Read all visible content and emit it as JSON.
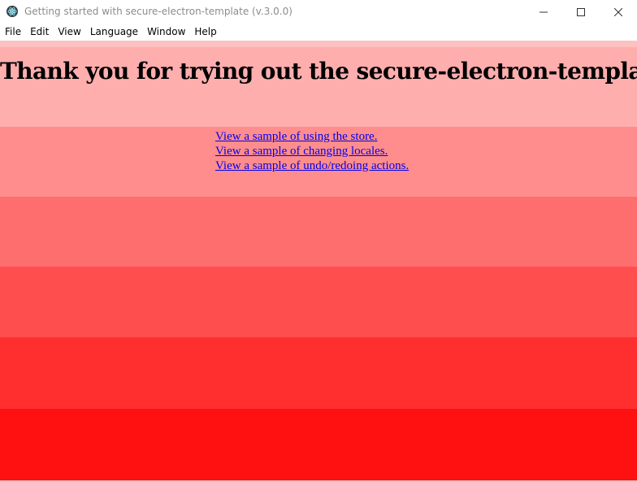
{
  "window": {
    "title": "Getting started with secure-electron-template (v.3.0.0)",
    "app_icon": "electron-icon",
    "controls": [
      "minimize-icon",
      "maximize-icon",
      "close-icon"
    ]
  },
  "menu": {
    "items": [
      "File",
      "Edit",
      "View",
      "Language",
      "Window",
      "Help"
    ]
  },
  "main": {
    "heading": "Thank you for trying out the secure-electron-template!",
    "links": [
      "View a sample of using the store.",
      "View a sample of changing locales.",
      "View a sample of undo/redoing actions."
    ]
  },
  "colors": {
    "link": "#0000ee",
    "band_1": "#ffaeae",
    "band_2": "#ff8d8d",
    "band_3": "#ff6e6e",
    "band_4": "#ff4e4e",
    "band_5": "#ff2f2f",
    "band_6": "#ff1111"
  }
}
